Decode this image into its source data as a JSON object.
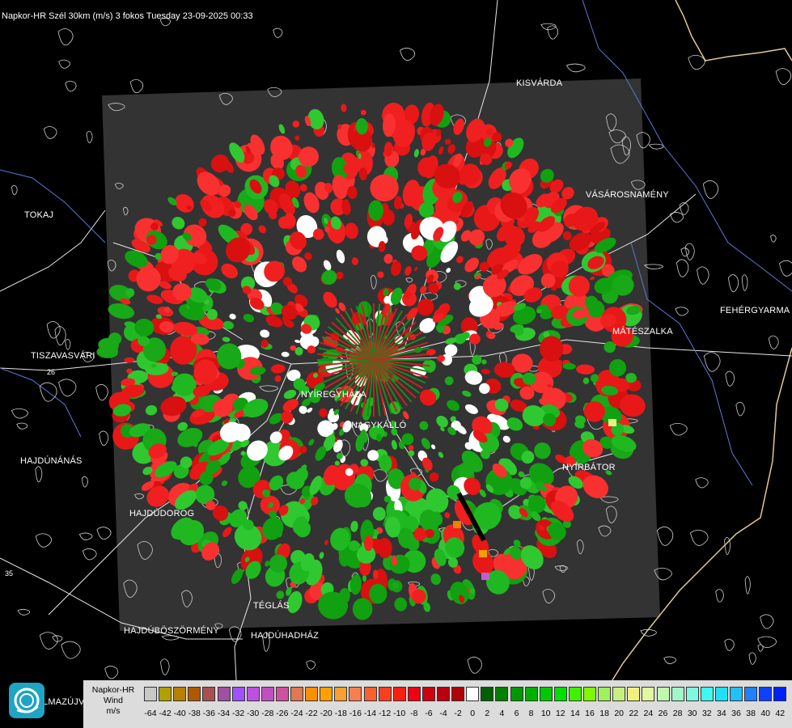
{
  "title": "Napkor-HR Szél 30km (m/s) 3 fokos Tuesday 23-09-2025 00:33",
  "cities": [
    {
      "id": "kisvarda",
      "name": "KISVÁRDA"
    },
    {
      "id": "tokaj",
      "name": "TOKAJ"
    },
    {
      "id": "vasarosnameny",
      "name": "VÁSÁROSNAMÉNY"
    },
    {
      "id": "fehergyarmat",
      "name": "FEHÉRGYARMA"
    },
    {
      "id": "mateszalka",
      "name": "MÁTÉSZALKA"
    },
    {
      "id": "tiszavasvari",
      "name": "TISZAVASVÁRI"
    },
    {
      "id": "nyiregyhaza",
      "name": "NYÍREGYHÁZA"
    },
    {
      "id": "nagykallo",
      "name": "NAGYKÁLLÓ"
    },
    {
      "id": "hajdunanas",
      "name": "HAJDÚNÁNÁS"
    },
    {
      "id": "nyirbator",
      "name": "NYÍRBÁTOR"
    },
    {
      "id": "hajdudorog",
      "name": "HAJDÚDOROG"
    },
    {
      "id": "teglas",
      "name": "TÉGLÁS"
    },
    {
      "id": "hajduboszormeny",
      "name": "HAJDÚBÖSZÖRMÉNY"
    },
    {
      "id": "hajduhadhaz",
      "name": "HAJDÚHADHÁZ"
    },
    {
      "id": "almazujvaros",
      "name": "LMAZÚJVÁR"
    }
  ],
  "road_labels": {
    "r26": "26",
    "r35": "35"
  },
  "legend": {
    "line1": "Napkor-HR",
    "line2": "Wind",
    "line3": "m/s",
    "swatch_colors": [
      "#c8c8c8",
      "#b0a000",
      "#b88000",
      "#b05800",
      "#a85050",
      "#a050a0",
      "#a050ff",
      "#c050e0",
      "#c050c0",
      "#d050a0",
      "#e07850",
      "#f89000",
      "#ffa000",
      "#f8a030",
      "#f88050",
      "#f86030",
      "#f84020",
      "#f82010",
      "#f00010",
      "#d00010",
      "#b80010",
      "#b00008",
      "#ffffff",
      "#006000",
      "#008000",
      "#009800",
      "#00b000",
      "#00c800",
      "#00e000",
      "#40f000",
      "#80f800",
      "#a0f060",
      "#c8f080",
      "#f0f080",
      "#e0f8a0",
      "#c0f8b0",
      "#a0f8c8",
      "#80f8e0",
      "#40f8f0",
      "#20e0f8",
      "#20c0f8",
      "#2080ff",
      "#1040ff",
      "#0020f8"
    ],
    "ticks": [
      "-64",
      "-42",
      "-40",
      "-38",
      "-36",
      "-34",
      "-32",
      "-30",
      "-28",
      "-26",
      "-24",
      "-22",
      "-20",
      "-18",
      "-16",
      "-14",
      "-12",
      "-10",
      "-8",
      "-6",
      "-4",
      "-2",
      "0",
      "2",
      "4",
      "6",
      "8",
      "10",
      "12",
      "14",
      "16",
      "18",
      "20",
      "22",
      "24",
      "26",
      "28",
      "30",
      "32",
      "34",
      "36",
      "38",
      "40",
      "42"
    ]
  }
}
